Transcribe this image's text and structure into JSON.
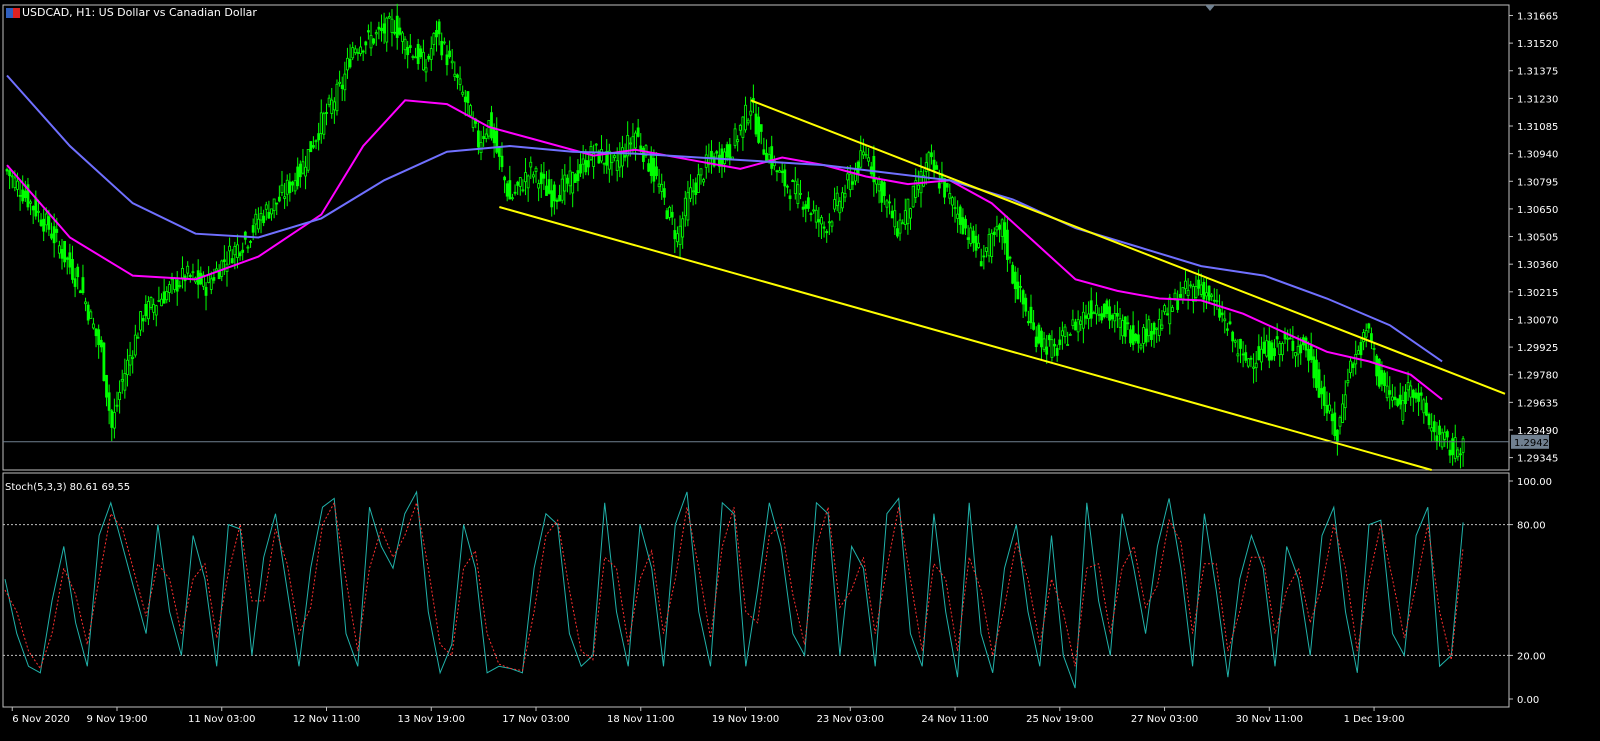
{
  "header": {
    "symbol": "USDCAD",
    "timeframe": "H1",
    "description": "US Dollar vs Canadian Dollar",
    "title": "USDCAD, H1:  US Dollar vs Canadian Dollar"
  },
  "colors": {
    "background": "#000000",
    "candle": "#00ff00",
    "ma_fast": "#ff00ff",
    "ma_slow": "#7070ff",
    "channel": "#ffff00",
    "bid_line": "#708090",
    "stoch_main": "#20b2aa",
    "stoch_signal": "#ff3030",
    "grid": "#c0c0c0"
  },
  "chart_data": [
    {
      "type": "candlestick",
      "symbol": "USDCAD",
      "timeframe": "H1",
      "ylim": [
        1.2928,
        1.3172
      ],
      "y_ticks": [
        "1.31665",
        "1.31520",
        "1.31375",
        "1.31230",
        "1.31085",
        "1.30940",
        "1.30795",
        "1.30650",
        "1.30505",
        "1.30360",
        "1.30215",
        "1.30070",
        "1.29925",
        "1.29780",
        "1.29635",
        "1.29490",
        "1.29345"
      ],
      "x_ticks": [
        "6 Nov 2020",
        "9 Nov 19:00",
        "11 Nov 03:00",
        "12 Nov 11:00",
        "13 Nov 19:00",
        "17 Nov 03:00",
        "18 Nov 11:00",
        "19 Nov 19:00",
        "23 Nov 03:00",
        "24 Nov 11:00",
        "25 Nov 19:00",
        "27 Nov 03:00",
        "30 Nov 11:00",
        "1 Dec 19:00"
      ],
      "current_price_label": "1.29428",
      "current_price": 1.29428,
      "close_path": [
        [
          0,
          1.3085
        ],
        [
          4,
          1.3055
        ],
        [
          7,
          1.3025
        ],
        [
          9,
          1.299
        ],
        [
          10,
          1.295
        ],
        [
          11,
          1.2975
        ],
        [
          13,
          1.301
        ],
        [
          15,
          1.302
        ],
        [
          17,
          1.303
        ],
        [
          19,
          1.3025
        ],
        [
          21,
          1.304
        ],
        [
          23,
          1.305
        ],
        [
          24,
          1.306
        ],
        [
          26,
          1.307
        ],
        [
          28,
          1.3085
        ],
        [
          30,
          1.311
        ],
        [
          32,
          1.313
        ],
        [
          33,
          1.315
        ],
        [
          35,
          1.3155
        ],
        [
          37,
          1.3162
        ],
        [
          38,
          1.3152
        ],
        [
          40,
          1.314
        ],
        [
          41,
          1.3158
        ],
        [
          42,
          1.3145
        ],
        [
          44,
          1.3118
        ],
        [
          45,
          1.31
        ],
        [
          46,
          1.311
        ],
        [
          47,
          1.309
        ],
        [
          48,
          1.307
        ],
        [
          50,
          1.3085
        ],
        [
          52,
          1.3072
        ],
        [
          54,
          1.308
        ],
        [
          56,
          1.3095
        ],
        [
          58,
          1.3088
        ],
        [
          60,
          1.3105
        ],
        [
          62,
          1.308
        ],
        [
          64,
          1.305
        ],
        [
          65,
          1.307
        ],
        [
          67,
          1.309
        ],
        [
          69,
          1.3095
        ],
        [
          71,
          1.312
        ],
        [
          72,
          1.31
        ],
        [
          74,
          1.308
        ],
        [
          76,
          1.307
        ],
        [
          78,
          1.3055
        ],
        [
          80,
          1.3075
        ],
        [
          82,
          1.3095
        ],
        [
          83,
          1.308
        ],
        [
          85,
          1.3055
        ],
        [
          86,
          1.3065
        ],
        [
          88,
          1.309
        ],
        [
          89,
          1.308
        ],
        [
          91,
          1.306
        ],
        [
          93,
          1.304
        ],
        [
          95,
          1.3055
        ],
        [
          96,
          1.303
        ],
        [
          98,
          1.3
        ],
        [
          100,
          1.299
        ],
        [
          102,
          1.3005
        ],
        [
          104,
          1.3015
        ],
        [
          106,
          1.3005
        ],
        [
          108,
          1.2998
        ],
        [
          110,
          1.3005
        ],
        [
          112,
          1.302
        ],
        [
          114,
          1.3025
        ],
        [
          116,
          1.3008
        ],
        [
          118,
          1.2985
        ],
        [
          120,
          1.299
        ],
        [
          122,
          1.2995
        ],
        [
          124,
          1.2992
        ],
        [
          126,
          1.296
        ],
        [
          127,
          1.2945
        ],
        [
          128,
          1.298
        ],
        [
          129,
          1.299
        ],
        [
          130,
          1.3002
        ],
        [
          131,
          1.2975
        ],
        [
          133,
          1.296
        ],
        [
          134,
          1.2975
        ],
        [
          136,
          1.295
        ],
        [
          138,
          1.2938
        ],
        [
          139,
          1.2943
        ]
      ],
      "moving_averages": [
        {
          "color": "#ff00ff",
          "points": [
            [
              0,
              1.3088
            ],
            [
              6,
              1.305
            ],
            [
              12,
              1.303
            ],
            [
              18,
              1.3028
            ],
            [
              24,
              1.304
            ],
            [
              30,
              1.3062
            ],
            [
              34,
              1.3098
            ],
            [
              38,
              1.3122
            ],
            [
              42,
              1.312
            ],
            [
              46,
              1.3108
            ],
            [
              50,
              1.3102
            ],
            [
              56,
              1.3093
            ],
            [
              60,
              1.3096
            ],
            [
              66,
              1.309
            ],
            [
              70,
              1.3086
            ],
            [
              74,
              1.3092
            ],
            [
              78,
              1.3088
            ],
            [
              82,
              1.3082
            ],
            [
              86,
              1.3078
            ],
            [
              90,
              1.308
            ],
            [
              94,
              1.3068
            ],
            [
              98,
              1.3048
            ],
            [
              102,
              1.3028
            ],
            [
              106,
              1.3022
            ],
            [
              110,
              1.3018
            ],
            [
              114,
              1.3017
            ],
            [
              118,
              1.301
            ],
            [
              122,
              1.3
            ],
            [
              126,
              1.299
            ],
            [
              130,
              1.2985
            ],
            [
              134,
              1.2978
            ],
            [
              137,
              1.2965
            ]
          ]
        },
        {
          "color": "#7070ff",
          "points": [
            [
              0,
              1.3135
            ],
            [
              6,
              1.3098
            ],
            [
              12,
              1.3068
            ],
            [
              18,
              1.3052
            ],
            [
              24,
              1.305
            ],
            [
              30,
              1.306
            ],
            [
              36,
              1.308
            ],
            [
              42,
              1.3095
            ],
            [
              48,
              1.3098
            ],
            [
              54,
              1.3095
            ],
            [
              60,
              1.3094
            ],
            [
              66,
              1.3092
            ],
            [
              72,
              1.309
            ],
            [
              78,
              1.3088
            ],
            [
              84,
              1.3084
            ],
            [
              90,
              1.308
            ],
            [
              96,
              1.307
            ],
            [
              102,
              1.3055
            ],
            [
              108,
              1.3045
            ],
            [
              114,
              1.3035
            ],
            [
              120,
              1.303
            ],
            [
              126,
              1.3018
            ],
            [
              132,
              1.3004
            ],
            [
              137,
              1.2985
            ]
          ]
        }
      ],
      "channel_lines": [
        {
          "from": [
            71,
            1.3122
          ],
          "to": [
            143,
            1.2968
          ]
        },
        {
          "from": [
            47,
            1.3066
          ],
          "to": [
            136,
            1.2928
          ]
        }
      ]
    },
    {
      "type": "line",
      "title": "Stoch(5,3,3) 80.61 69.55",
      "indicator": "Stoch(5,3,3)",
      "main_value": 80.61,
      "signal_value": 69.55,
      "ylim": [
        0,
        100
      ],
      "levels": [
        20,
        80
      ],
      "y_ticks": [
        "100.00",
        "80.00",
        "20.00",
        "0.00"
      ],
      "series": [
        {
          "color": "#20b2aa",
          "values": [
            55,
            30,
            15,
            12,
            45,
            70,
            35,
            15,
            75,
            90,
            70,
            50,
            30,
            80,
            40,
            20,
            75,
            55,
            15,
            80,
            78,
            20,
            65,
            85,
            50,
            15,
            60,
            88,
            92,
            30,
            15,
            88,
            70,
            60,
            85,
            95,
            40,
            12,
            25,
            80,
            60,
            12,
            15,
            14,
            12,
            60,
            85,
            80,
            30,
            15,
            20,
            90,
            40,
            15,
            80,
            60,
            15,
            80,
            95,
            40,
            15,
            90,
            85,
            15,
            50,
            90,
            70,
            30,
            20,
            90,
            85,
            20,
            70,
            60,
            15,
            85,
            92,
            30,
            15,
            85,
            40,
            10,
            90,
            30,
            12,
            60,
            80,
            40,
            15,
            75,
            20,
            5,
            90,
            45,
            20,
            85,
            60,
            30,
            70,
            92,
            60,
            15,
            85,
            50,
            10,
            55,
            75,
            60,
            15,
            70,
            55,
            20,
            75,
            88,
            40,
            12,
            80,
            82,
            30,
            20,
            75,
            88,
            15,
            20,
            81
          ]
        },
        {
          "color": "#ff3030",
          "values": [
            50,
            40,
            22,
            14,
            30,
            60,
            48,
            25,
            55,
            85,
            78,
            58,
            38,
            62,
            55,
            30,
            55,
            62,
            28,
            58,
            80,
            45,
            45,
            78,
            62,
            30,
            42,
            80,
            90,
            55,
            22,
            60,
            78,
            65,
            75,
            90,
            60,
            25,
            20,
            60,
            68,
            30,
            16,
            14,
            13,
            40,
            75,
            82,
            50,
            22,
            18,
            65,
            60,
            25,
            55,
            68,
            30,
            55,
            88,
            60,
            28,
            70,
            88,
            40,
            35,
            75,
            80,
            48,
            25,
            70,
            88,
            42,
            50,
            65,
            30,
            60,
            88,
            55,
            22,
            62,
            55,
            22,
            65,
            50,
            20,
            42,
            72,
            55,
            25,
            55,
            40,
            15,
            60,
            62,
            30,
            60,
            70,
            42,
            52,
            82,
            72,
            30,
            62,
            62,
            22,
            40,
            65,
            65,
            30,
            50,
            60,
            35,
            52,
            80,
            60,
            22,
            55,
            80,
            55,
            28,
            52,
            80,
            40,
            18,
            69.55
          ]
        }
      ]
    }
  ]
}
